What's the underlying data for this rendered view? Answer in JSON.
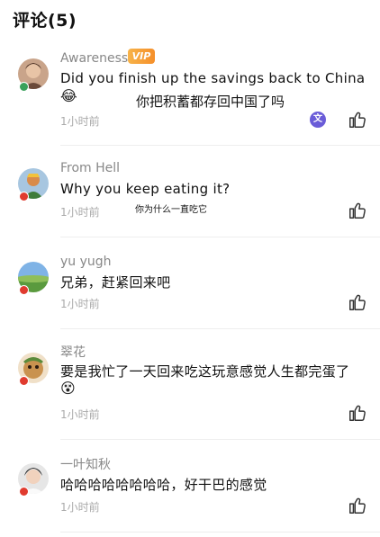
{
  "header": {
    "title": "评论(5)"
  },
  "comments": [
    {
      "username": "Awareness",
      "vip_label": "VIP",
      "text": "Did you finish up the savings back to China",
      "emoji": "😂",
      "translation": "你把积蓄都存回中国了吗",
      "time": "1小时前"
    },
    {
      "username": "From Hell",
      "text": "Why you keep eating it?",
      "translation": "你为什么一直吃它",
      "time": "1小时前"
    },
    {
      "username": "yu yugh",
      "text": "兄弟，赶紧回来吧",
      "time": "1小时前"
    },
    {
      "username": "翠花",
      "text": "要是我忙了一天回来吃这玩意感觉人生都完蛋了",
      "emoji": "😵",
      "time": "1小时前"
    },
    {
      "username": "一叶知秋",
      "text": "哈哈哈哈哈哈哈哈，好干巴的感觉",
      "time": "1小时前"
    }
  ],
  "colors": {
    "vip_badge": "#f7a03c",
    "translate_icon": "#6a5cd8",
    "avatar_status_dot": "#e03b2f"
  }
}
